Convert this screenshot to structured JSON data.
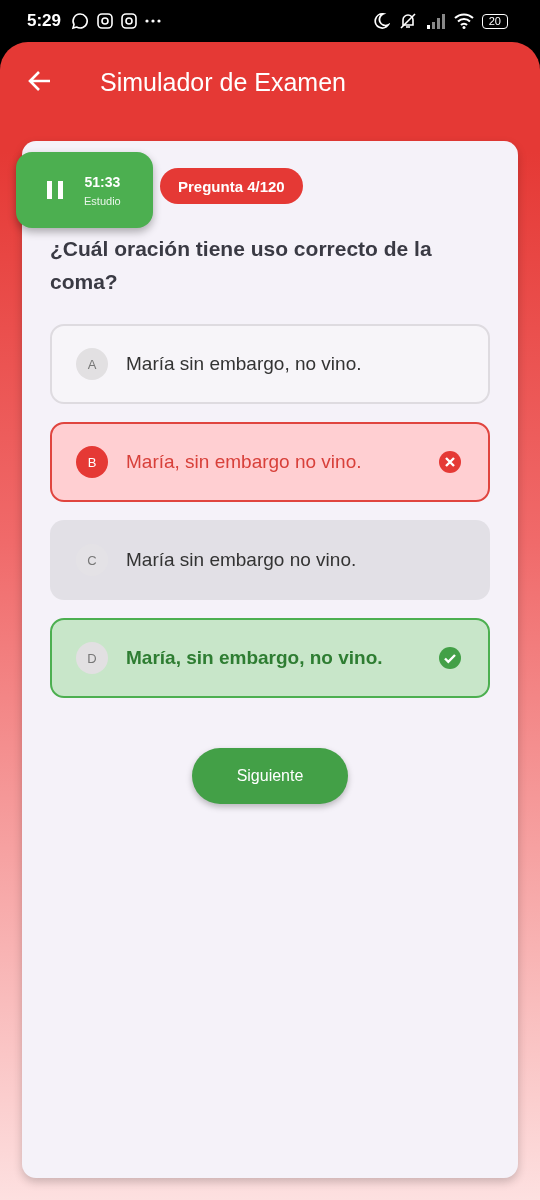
{
  "status_bar": {
    "time": "5:29",
    "battery": "20"
  },
  "app_bar": {
    "title": "Simulador de Examen"
  },
  "timer": {
    "time": "51:33",
    "mode": "Estudio"
  },
  "question_badge": "Pregunta 4/120",
  "question": "¿Cuál oración tiene uso correcto de la coma?",
  "options": [
    {
      "letter": "A",
      "text": "María sin embargo, no vino.",
      "kind": "plain"
    },
    {
      "letter": "B",
      "text": "María, sin embargo no vino.",
      "kind": "wrong"
    },
    {
      "letter": "C",
      "text": "María sin embargo no vino.",
      "kind": "muted"
    },
    {
      "letter": "D",
      "text": "María, sin embargo, no vino.",
      "kind": "correct"
    }
  ],
  "next_button": "Siguiente"
}
